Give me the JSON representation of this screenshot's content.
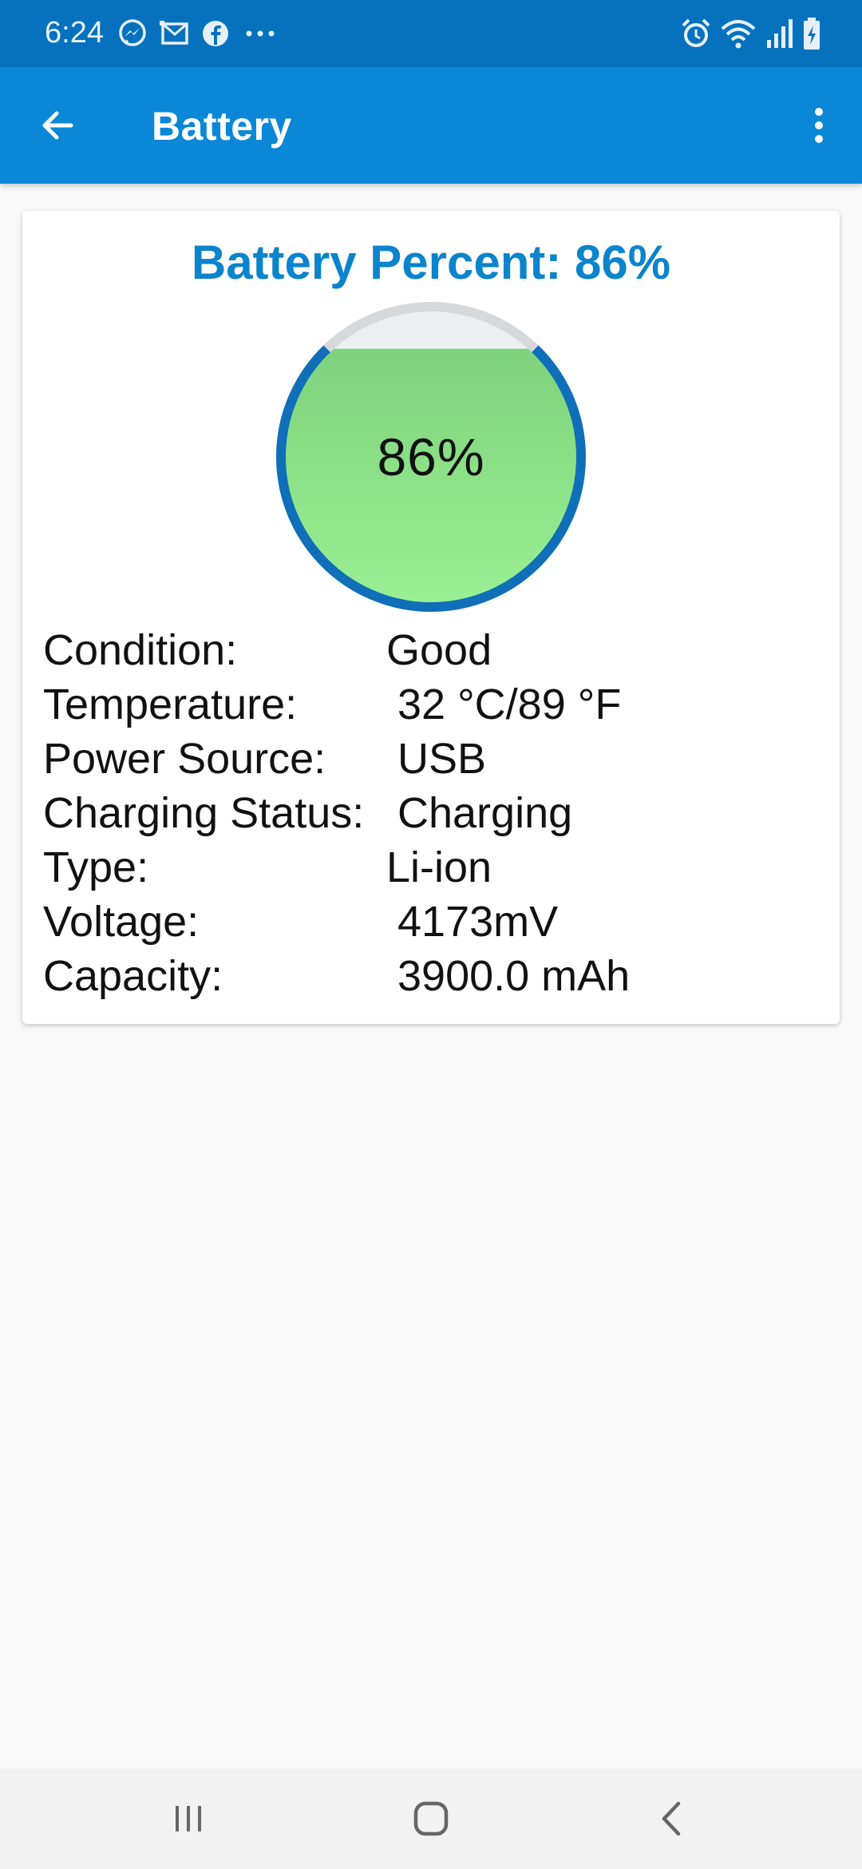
{
  "status_bar": {
    "time": "6:24",
    "left_icons": [
      "messenger-icon",
      "email-icon",
      "facebook-icon",
      "more-notifications-icon"
    ],
    "right_icons": [
      "alarm-icon",
      "wifi-icon",
      "cell-signal-icon",
      "battery-charging-icon"
    ],
    "background": "#0672bd"
  },
  "app_bar": {
    "title": "Battery",
    "back_icon": "arrow-back-icon",
    "menu_icon": "more-vert-icon",
    "background": "#0a88d7"
  },
  "battery_card": {
    "heading": "Battery Percent: 86%",
    "gauge": {
      "level": 86,
      "label": "86%",
      "ring_color": "#0f6fb8",
      "fill_color": "#8fe08a",
      "empty_color": "#eceff1"
    },
    "details": [
      {
        "label": "Condition:",
        "value": "Good"
      },
      {
        "label": "Temperature:",
        "value": "32 °C/89 °F"
      },
      {
        "label": "Power Source:",
        "value": "USB"
      },
      {
        "label": "Charging Status:",
        "value": "Charging"
      },
      {
        "label": "Type:",
        "value": "Li-ion"
      },
      {
        "label": "Voltage:",
        "value": "4173mV"
      },
      {
        "label": "Capacity:",
        "value": "3900.0 mAh"
      }
    ]
  },
  "nav_bar": {
    "buttons": [
      "recent-apps-icon",
      "home-icon",
      "back-icon"
    ]
  },
  "colors": {
    "accent": "#0a84cc",
    "page_background": "#f8f8f8"
  }
}
